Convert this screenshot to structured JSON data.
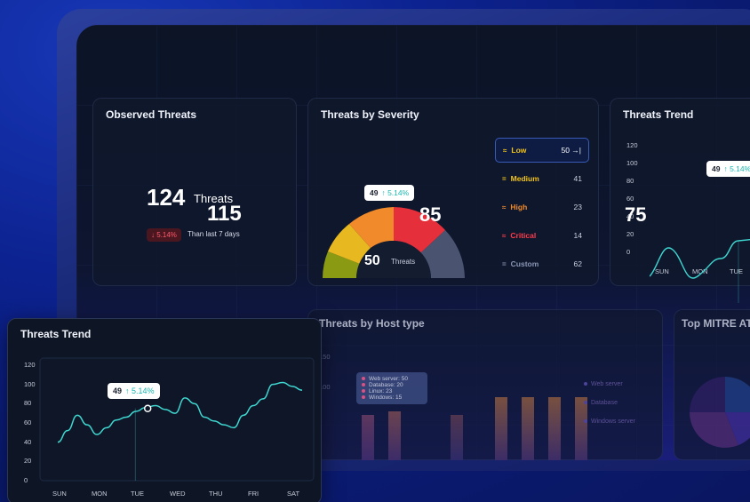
{
  "observed": {
    "title": "Observed Threats",
    "value": "124",
    "unit": "Threats",
    "secondary": "115",
    "change": "↓ 5.14%",
    "compare": "Than last 7 days"
  },
  "severity": {
    "title": "Threats by Severity",
    "tooltip_value": "49",
    "tooltip_change": "↑ 5.14%",
    "side_value": "85",
    "center_value": "50",
    "center_label": "Threats",
    "legend": [
      {
        "icon": "≈",
        "label": "Low",
        "value": "50 →|",
        "color": "#f2c418"
      },
      {
        "icon": "=",
        "label": "Medium",
        "value": "41",
        "color": "#f2c418"
      },
      {
        "icon": "≈",
        "label": "High",
        "value": "23",
        "color": "#f08a2a"
      },
      {
        "icon": "≈",
        "label": "Critical",
        "value": "14",
        "color": "#ff3b4a"
      },
      {
        "icon": "=",
        "label": "Custom",
        "value": "62",
        "color": "#8a96b4"
      }
    ]
  },
  "trend_back": {
    "title": "Threats Trend",
    "side_value": "75",
    "tooltip_value": "49",
    "tooltip_change": "↑ 5.14%",
    "yticks": [
      "120",
      "100",
      "80",
      "60",
      "40",
      "20",
      "0"
    ],
    "xticks": [
      "SUN",
      "MON",
      "TUE"
    ]
  },
  "host": {
    "title": "Threats by Host type",
    "ytick_a": "150",
    "ytick_b": "100",
    "tooltip": [
      "Web server: 50",
      "Database: 20",
      "Linux: 23",
      "Windows: 15"
    ],
    "legend": [
      "Web server",
      "Database",
      "Windows server"
    ]
  },
  "mitre": {
    "title": "Top MITRE AT"
  },
  "trend_front": {
    "title": "Threats Trend",
    "tooltip_value": "49",
    "tooltip_change": "↑ 5.14%",
    "yticks": [
      "120",
      "100",
      "80",
      "60",
      "40",
      "20",
      "0"
    ],
    "xticks": [
      "SUN",
      "MON",
      "TUE",
      "WED",
      "THU",
      "FRI",
      "SAT"
    ]
  },
  "chart_data": {
    "type": "line",
    "title": "Threats Trend",
    "xlabel": "",
    "ylabel": "",
    "categories": [
      "SUN",
      "MON",
      "TUE",
      "WED",
      "THU",
      "FRI",
      "SAT"
    ],
    "x": [
      0,
      0.25,
      0.5,
      0.75,
      1,
      1.25,
      1.5,
      1.75,
      2,
      2.25,
      2.5,
      2.75,
      3,
      3.25,
      3.5,
      3.75,
      4,
      4.25,
      4.5,
      4.75,
      5,
      5.25,
      5.5,
      5.75,
      6,
      6.25
    ],
    "y": [
      40,
      52,
      68,
      58,
      48,
      55,
      63,
      66,
      72,
      76,
      78,
      74,
      70,
      86,
      80,
      66,
      62,
      58,
      55,
      68,
      78,
      85,
      100,
      102,
      98,
      94
    ],
    "ylim": [
      0,
      120
    ],
    "marker": {
      "x": 2.3,
      "y": 75
    },
    "grid": false,
    "legend": "none",
    "color": "#3fd7d0"
  }
}
